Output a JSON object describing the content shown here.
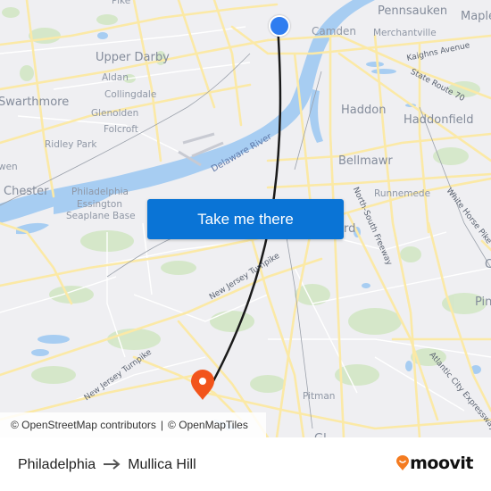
{
  "map": {
    "labels": {
      "pike_top": "Pike",
      "upper_darby": "Upper Darby",
      "aldan": "Aldan",
      "collingdale": "Collingdale",
      "swarthmore": "Swarthmore",
      "glenolden": "Glenolden",
      "folcroft": "Folcroft",
      "ridley_park": "Ridley Park",
      "wen": "wen",
      "chester": "Chester",
      "essington": "Philadelphia\nEssington\nSeaplane Base",
      "essington_1": "Philadelphia",
      "essington_2": "Essington",
      "essington_3": "Seaplane Base",
      "delaware_river": "Delaware River",
      "pennsauken": "Pennsauken",
      "maple": "Maple",
      "camden": "Camden",
      "merchantville": "Merchantville",
      "kaighns_avenue": "Kaighns Avenue",
      "state_route_70": "State Route 70",
      "haddon": "Haddon",
      "haddonfield": "Haddonfield",
      "bellmawr": "Bellmawr",
      "runnemede": "Runnemede",
      "north_south_freeway": "North-South Freeway",
      "white_horse_pike": "White Horse Pike",
      "rd_partial": "rd",
      "pin_partial": "Pin",
      "c_partial": "C",
      "nj_turnpike_upper": "New Jersey Turnpike",
      "nj_turnpike_lower": "New Jersey Turnpike",
      "pitman": "Pitman",
      "atlantic_city_expressway": "Atlantic City Expressway",
      "glassboro_partial": "Gl"
    },
    "origin_marker": {
      "icon": "origin-dot-icon",
      "color": "#2f7df0"
    },
    "destination_marker": {
      "icon": "destination-pin-icon",
      "color": "#f2541b"
    },
    "route_line_color": "#1a1a1a"
  },
  "cta": {
    "label": "Take me there",
    "color": "#0a74d6"
  },
  "attribution": {
    "osm": "© OpenStreetMap contributors",
    "separator": "|",
    "omt": "© OpenMapTiles"
  },
  "footer": {
    "origin": "Philadelphia",
    "arrow_icon": "arrow-right-icon",
    "destination": "Mullica Hill",
    "brand": "moovit",
    "brand_color": "#f47b20"
  }
}
